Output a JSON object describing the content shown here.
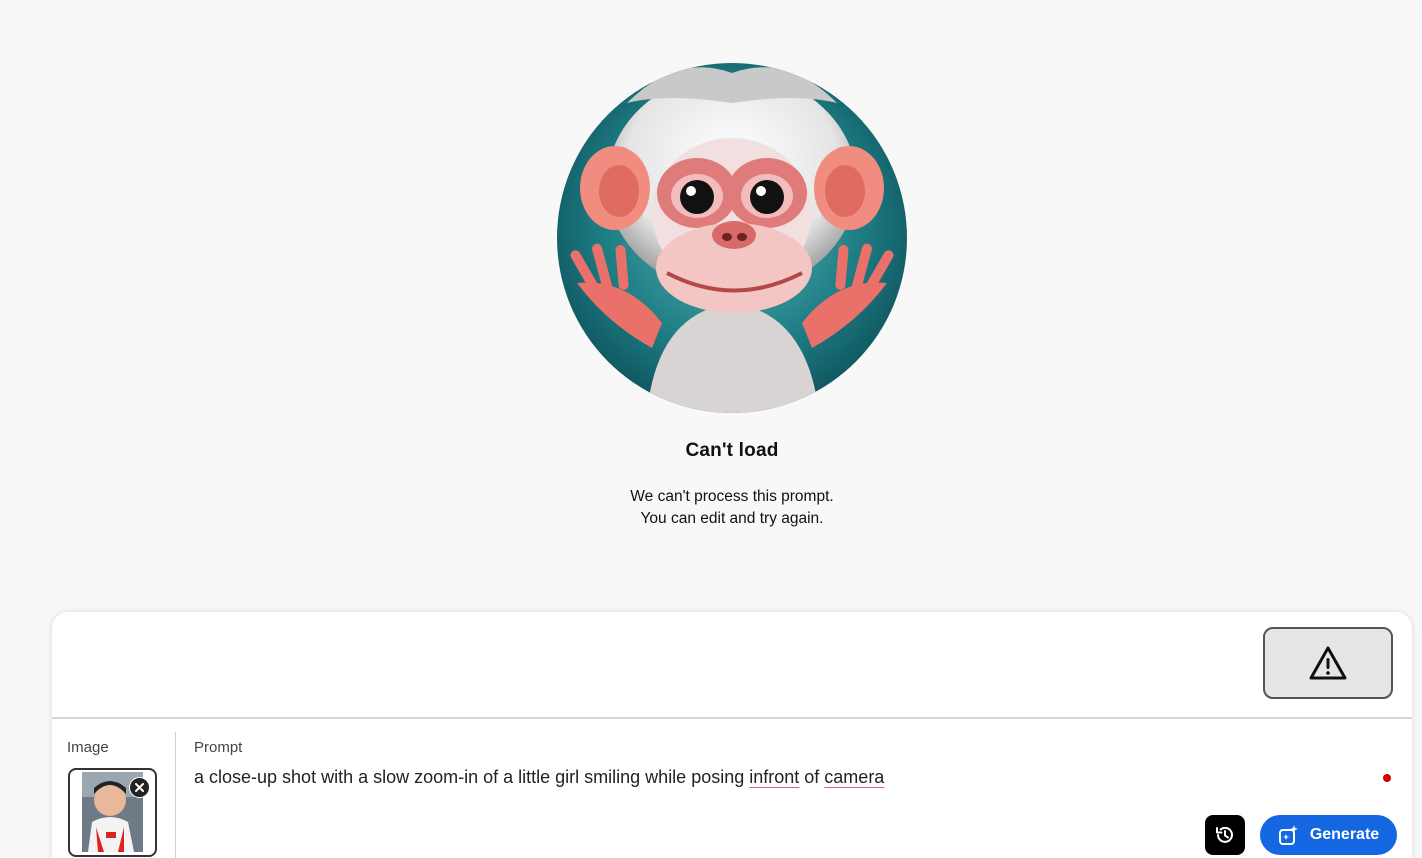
{
  "illustration": {
    "icon": "monkey-illustration",
    "accent_color": "#1f7f86"
  },
  "status": {
    "title": "Can't load",
    "message_line1": "We can't process this prompt.",
    "message_line2": "You can edit and try again."
  },
  "panel": {
    "warning_icon": "warning-triangle-icon",
    "image_label": "Image",
    "prompt_label": "Prompt",
    "prompt": {
      "part1": "a close-up shot with a slow zoom-in of a little girl smiling while posing ",
      "word_infront": "infront",
      "part2": " of ",
      "word_camera": "camera"
    },
    "history_icon": "history-icon",
    "generate_label": "Generate",
    "generate_icon": "generate-sparkle-icon",
    "colors": {
      "generate": "#1467e0",
      "required_dot": "#d40000"
    }
  }
}
